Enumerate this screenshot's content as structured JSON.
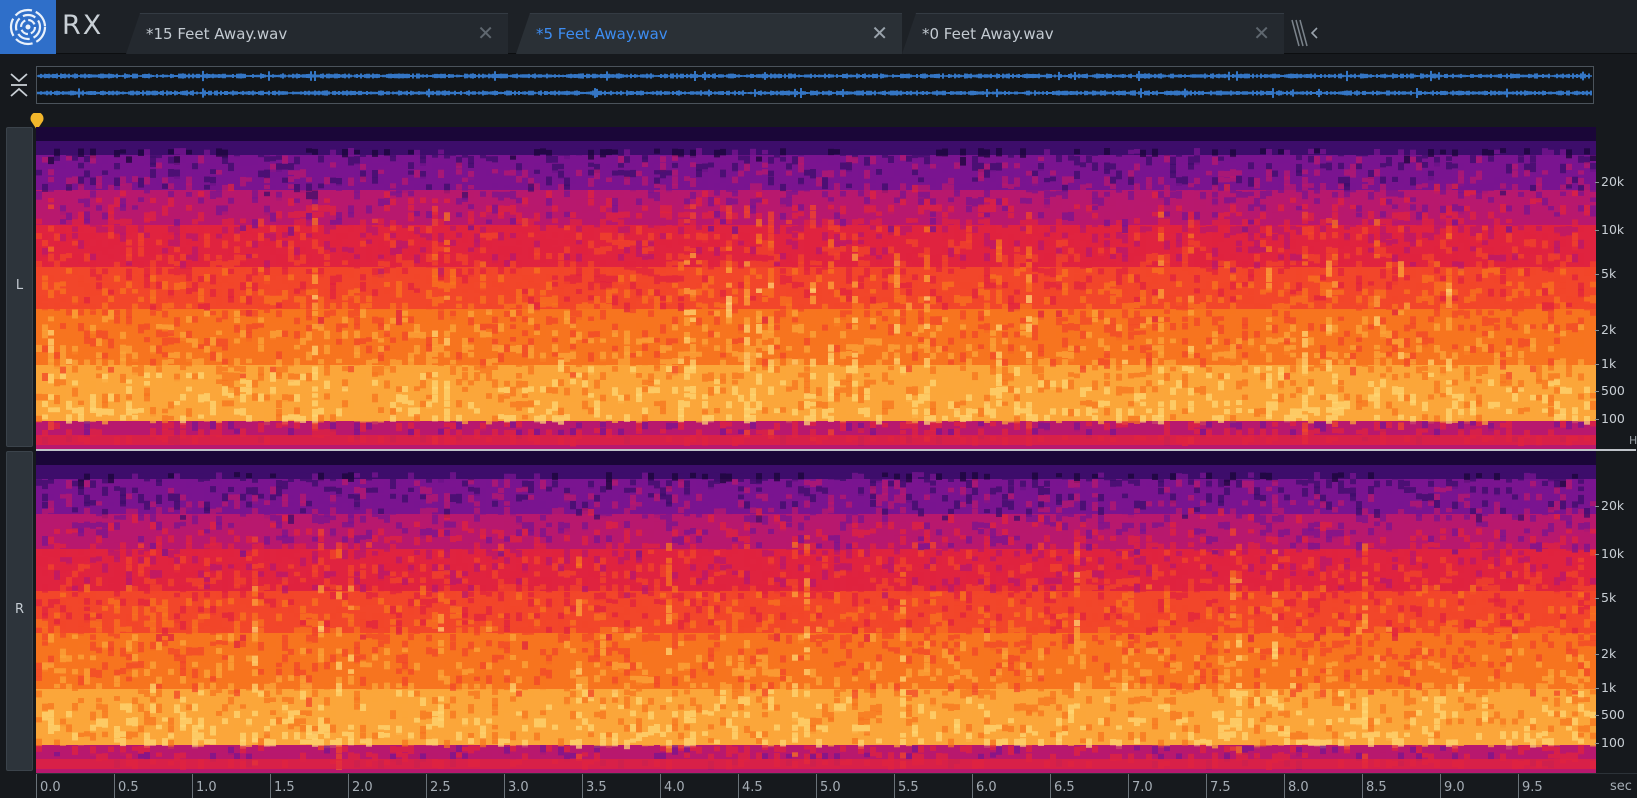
{
  "app": {
    "logo_icon": "rx-spiral-logo-icon",
    "name": "RX",
    "brand_color": "#2f6fc9"
  },
  "tabs": [
    {
      "label": "*15 Feet Away.wav",
      "active": false,
      "close_icon": "close-icon"
    },
    {
      "label": "*5 Feet Away.wav",
      "active": true,
      "close_icon": "close-icon"
    },
    {
      "label": "*0 Feet Away.wav",
      "active": false,
      "close_icon": "close-icon"
    }
  ],
  "tab_overflow_icon": "tab-overflow-icon",
  "tab_close_glyph": "✕",
  "overview": {
    "collapse_icon": "collapse-expand-icon",
    "waveform_color": "#3d8ef0"
  },
  "playhead": {
    "icon": "playhead-marker-icon",
    "color": "#f2b62b"
  },
  "channels": [
    {
      "label": "L"
    },
    {
      "label": "R"
    }
  ],
  "frequency_axis": {
    "ticks": [
      "20k",
      "10k",
      "5k",
      "2k",
      "1k",
      "500",
      "100"
    ],
    "unit": "H"
  },
  "time_axis": {
    "ticks": [
      "0.0",
      "0.5",
      "1.0",
      "1.5",
      "2.0",
      "2.5",
      "3.0",
      "3.5",
      "4.0",
      "4.5",
      "5.0",
      "5.5",
      "6.0",
      "6.5",
      "7.0",
      "7.5",
      "8.0",
      "8.5",
      "9.0",
      "9.5"
    ],
    "unit": "sec"
  },
  "spectrogram_colors": [
    "#1a0638",
    "#3d0d6b",
    "#7a1490",
    "#b8186e",
    "#e0233f",
    "#f2462a",
    "#f7741f",
    "#fba63a",
    "#fdd673"
  ]
}
